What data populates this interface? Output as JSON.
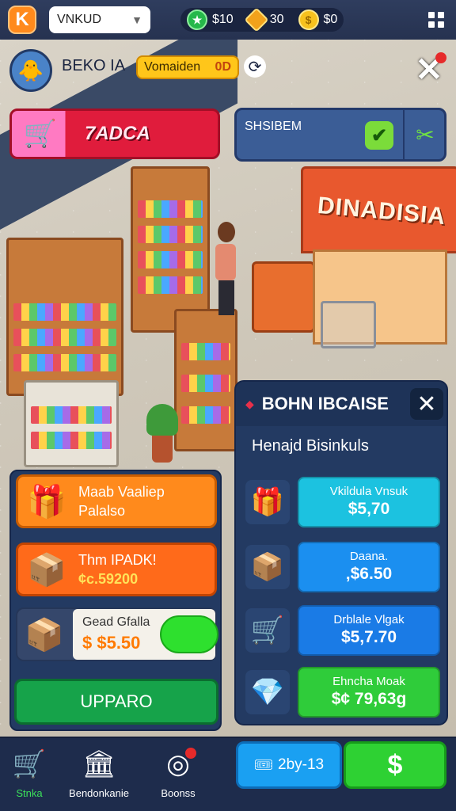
{
  "topbar": {
    "logo_letter": "K",
    "dropdown_value": "VNKUD",
    "currencies": [
      {
        "icon": "star-gem-icon",
        "value": "$10"
      },
      {
        "icon": "gold-gem-icon",
        "value": "30"
      },
      {
        "icon": "coin-icon",
        "value": "$0"
      }
    ]
  },
  "player": {
    "name": "BEKO IA",
    "vip_label": "Vomaiden",
    "vip_value": "0D"
  },
  "banners": {
    "store_label": "7ADCA",
    "promo_label": "SHSIBEM"
  },
  "scene": {
    "shop_sign": "DINADISIA"
  },
  "offers": [
    {
      "title": "Maab Vaaliep",
      "subtitle": "Palalso",
      "icon": "blue-gift-box-icon"
    },
    {
      "title": "Thm IPADK!",
      "price": "¢c.59200",
      "icon": "cardboard-box-icon"
    },
    {
      "title": "Gead Gfalla",
      "price": "$ $5.50",
      "icon": "package-box-icon"
    }
  ],
  "upgrade_label": "UPPARO",
  "modal": {
    "title": "BOHN IBCAISE",
    "subtitle": "Henajd Bisinkuls",
    "packs": [
      {
        "name": "Vkildula Vnsuk",
        "price": "$5,70",
        "icon": "orange-gift-icon",
        "color": "#1cc2e0"
      },
      {
        "name": "Daana.",
        "price": "‚$6.50",
        "icon": "wooden-crate-icon",
        "color": "#1b8ff0"
      },
      {
        "name": "Drblale Vlgak",
        "price": "$5,7.70",
        "icon": "shopping-cart-icon",
        "color": "#1a7be6"
      },
      {
        "name": "Ehncha Moak",
        "price": "$¢ 79,63g",
        "icon": "pink-gem-box-icon",
        "color": "#2fcc3a"
      }
    ]
  },
  "bottom": {
    "nav": [
      {
        "label": "Stnka",
        "icon": "store-cart-icon"
      },
      {
        "label": "Bendonkanie",
        "icon": "building-icon"
      },
      {
        "label": "Boonss",
        "icon": "target-icon"
      }
    ],
    "buy_label": "2by-13",
    "cash_icon": "dollar-icon"
  }
}
